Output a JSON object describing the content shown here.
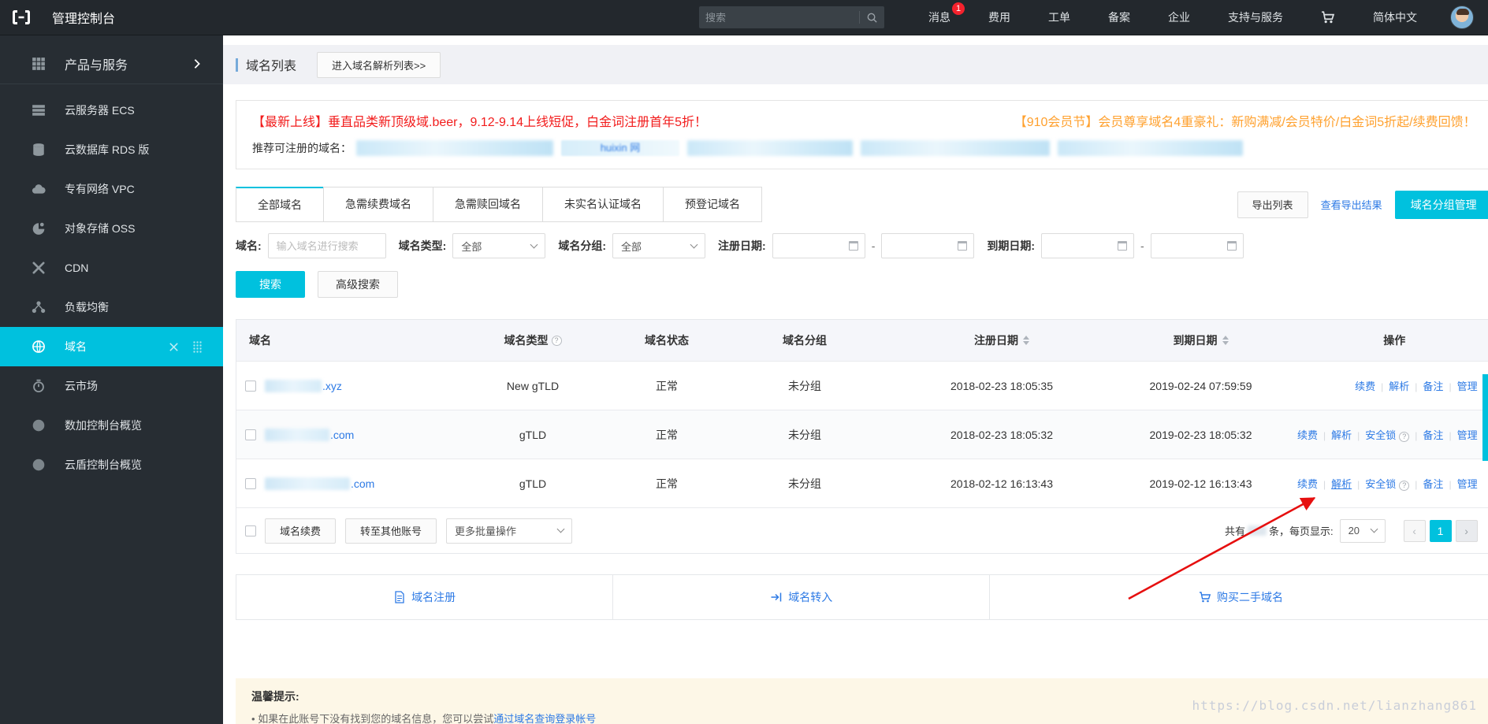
{
  "topnav": {
    "title": "管理控制台",
    "search_placeholder": "搜索",
    "message_label": "消息",
    "message_badge": "1",
    "items": [
      "费用",
      "工单",
      "备案",
      "企业",
      "支持与服务"
    ],
    "language": "简体中文"
  },
  "sidebar": {
    "products_label": "产品与服务",
    "items": [
      {
        "label": "云服务器 ECS"
      },
      {
        "label": "云数据库 RDS 版"
      },
      {
        "label": "专有网络 VPC"
      },
      {
        "label": "对象存储 OSS"
      },
      {
        "label": "CDN"
      },
      {
        "label": "负载均衡"
      },
      {
        "label": "域名"
      },
      {
        "label": "云市场"
      },
      {
        "label": "数加控制台概览"
      },
      {
        "label": "云盾控制台概览"
      }
    ]
  },
  "page_head": {
    "title": "域名列表",
    "resolve_list_button": "进入域名解析列表>>"
  },
  "banner": {
    "promo_left": "【最新上线】垂直品类新顶级域.beer，9.12-9.14上线短促，白金词注册首年5折！",
    "promo_right": "【910会员节】会员尊享域名4重豪礼：新购满减/会员特价/白金词5折起/续费回馈！",
    "recommend_label": "推荐可注册的域名：",
    "redacted_fragment": "huixin 网"
  },
  "tabs": [
    {
      "label": "全部域名"
    },
    {
      "label": "急需续费域名"
    },
    {
      "label": "急需赎回域名"
    },
    {
      "label": "未实名认证域名"
    },
    {
      "label": "预登记域名"
    }
  ],
  "toolbar": {
    "export_button": "导出列表",
    "view_export_link": "查看导出结果",
    "group_manage_button": "域名分组管理"
  },
  "filters": {
    "domain_label": "域名:",
    "domain_placeholder": "输入域名进行搜索",
    "type_label": "域名类型:",
    "type_value": "全部",
    "group_label": "域名分组:",
    "group_value": "全部",
    "reg_date_label": "注册日期:",
    "exp_date_label": "到期日期:",
    "date_separator": "-",
    "search_button": "搜索",
    "advanced_search_button": "高级搜索"
  },
  "table": {
    "headers": {
      "domain": "域名",
      "type": "域名类型",
      "status": "域名状态",
      "group": "域名分组",
      "reg_date": "注册日期",
      "exp_date": "到期日期",
      "actions": "操作"
    },
    "rows": [
      {
        "domain_suffix": ".xyz",
        "type": "New gTLD",
        "status": "正常",
        "group": "未分组",
        "reg_date": "2018-02-23 18:05:35",
        "exp_date": "2019-02-24 07:59:59",
        "actions": {
          "renew": "续费",
          "resolve": "解析",
          "remark": "备注",
          "manage": "管理"
        }
      },
      {
        "domain_suffix": ".com",
        "type": "gTLD",
        "status": "正常",
        "group": "未分组",
        "reg_date": "2018-02-23 18:05:32",
        "exp_date": "2019-02-23 18:05:32",
        "actions": {
          "renew": "续费",
          "resolve": "解析",
          "lock": "安全锁",
          "remark": "备注",
          "manage": "管理"
        }
      },
      {
        "domain_suffix": ".com",
        "type": "gTLD",
        "status": "正常",
        "group": "未分组",
        "reg_date": "2018-02-12 16:13:43",
        "exp_date": "2019-02-12 16:13:43",
        "actions": {
          "renew": "续费",
          "resolve": "解析",
          "lock": "安全锁",
          "remark": "备注",
          "manage": "管理"
        }
      }
    ]
  },
  "batch": {
    "renew_button": "域名续费",
    "transfer_button": "转至其他账号",
    "more_select": "更多批量操作",
    "total_prefix": "共有",
    "total_suffix": "条，每页显示:",
    "page_size": "20",
    "pager_prev": "‹",
    "current_page": "1",
    "pager_next": "›"
  },
  "quick_links": [
    {
      "label": "域名注册"
    },
    {
      "label": "域名转入"
    },
    {
      "label": "购买二手域名"
    }
  ],
  "tip": {
    "title": "温馨提示:",
    "bullet": "•",
    "text": "如果在此账号下没有找到您的域名信息，您可以尝试",
    "link": "通过域名查询登录帐号"
  },
  "watermark": "https://blog.csdn.net/lianzhang861"
}
